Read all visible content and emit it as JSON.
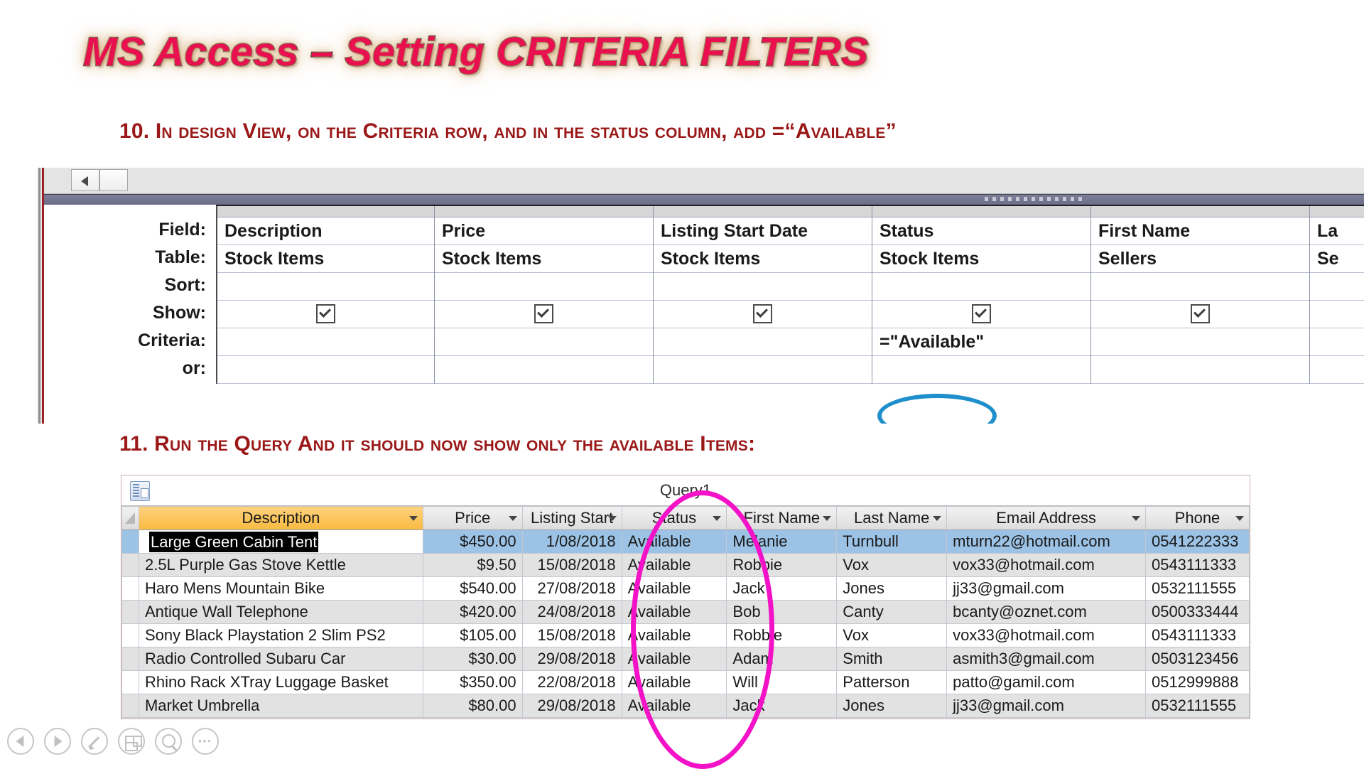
{
  "slide": {
    "title": "MS Access – Setting CRITERIA FILTERS",
    "title_color": "#E8104E",
    "heading_color": "#9A1818",
    "step10": "10. In design View, on the Criteria row, and in the status column, add =“Available”",
    "step11": "11. Run the Query And it should now show only the available Items:"
  },
  "design_grid": {
    "row_labels": [
      "Field:",
      "Table:",
      "Sort:",
      "Show:",
      "Criteria:",
      "or:"
    ],
    "columns": [
      {
        "field": "Description",
        "table": "Stock Items",
        "sort": "",
        "show": true,
        "criteria": "",
        "or": ""
      },
      {
        "field": "Price",
        "table": "Stock Items",
        "sort": "",
        "show": true,
        "criteria": "",
        "or": ""
      },
      {
        "field": "Listing Start Date",
        "table": "Stock Items",
        "sort": "",
        "show": true,
        "criteria": "",
        "or": ""
      },
      {
        "field": "Status",
        "table": "Stock Items",
        "sort": "",
        "show": true,
        "criteria": "=\"Available\"",
        "or": ""
      },
      {
        "field": "First Name",
        "table": "Sellers",
        "sort": "",
        "show": true,
        "criteria": "",
        "or": ""
      },
      {
        "field": "La",
        "table": "Se",
        "sort": "",
        "show": false,
        "criteria": "",
        "or": ""
      }
    ],
    "annotations": {
      "criteria_ellipse_color": "#1F8FCB",
      "status_ellipse_color": "#1F8FCB",
      "available_ellipse_color": "#F312C7"
    }
  },
  "datasheet": {
    "window_title": "Query1",
    "selected_column": "Description",
    "edit_cell_value": "Large Green Cabin Tent",
    "status_ellipse_color": "#F312C7",
    "columns": [
      "Description",
      "Price",
      "Listing Start",
      "Status",
      "First Name",
      "Last Name",
      "Email Address",
      "Phone"
    ],
    "rows": [
      {
        "description": "Large Green Cabin Tent",
        "price": "$450.00",
        "listing_start": "1/08/2018",
        "status": "Available",
        "first_name": "Melanie",
        "last_name": "Turnbull",
        "email": "mturn22@hotmail.com",
        "phone": "0541222333"
      },
      {
        "description": "2.5L Purple Gas Stove Kettle",
        "price": "$9.50",
        "listing_start": "15/08/2018",
        "status": "Available",
        "first_name": "Robbie",
        "last_name": "Vox",
        "email": "vox33@hotmail.com",
        "phone": "0543111333"
      },
      {
        "description": "Haro Mens Mountain Bike",
        "price": "$540.00",
        "listing_start": "27/08/2018",
        "status": "Available",
        "first_name": "Jack",
        "last_name": "Jones",
        "email": "jj33@gmail.com",
        "phone": "0532111555"
      },
      {
        "description": "Antique Wall Telephone",
        "price": "$420.00",
        "listing_start": "24/08/2018",
        "status": "Available",
        "first_name": "Bob",
        "last_name": "Canty",
        "email": "bcanty@oznet.com",
        "phone": "0500333444"
      },
      {
        "description": "Sony Black Playstation 2 Slim PS2",
        "price": "$105.00",
        "listing_start": "15/08/2018",
        "status": "Available",
        "first_name": "Robbie",
        "last_name": "Vox",
        "email": "vox33@hotmail.com",
        "phone": "0543111333"
      },
      {
        "description": "Radio Controlled Subaru Car",
        "price": "$30.00",
        "listing_start": "29/08/2018",
        "status": "Available",
        "first_name": "Adam",
        "last_name": "Smith",
        "email": "asmith3@gmail.com",
        "phone": "0503123456"
      },
      {
        "description": "Rhino Rack XTray Luggage Basket",
        "price": "$350.00",
        "listing_start": "22/08/2018",
        "status": "Available",
        "first_name": "Will",
        "last_name": "Patterson",
        "email": "patto@gamil.com",
        "phone": "0512999888"
      },
      {
        "description": "Market Umbrella",
        "price": "$80.00",
        "listing_start": "29/08/2018",
        "status": "Available",
        "first_name": "Jack",
        "last_name": "Jones",
        "email": "jj33@gmail.com",
        "phone": "0532111555"
      }
    ]
  },
  "presentation_toolbar": {
    "buttons": [
      "previous-slide-icon",
      "next-slide-icon",
      "pen-icon",
      "slides-grid-icon",
      "zoom-icon",
      "more-options-icon"
    ]
  }
}
